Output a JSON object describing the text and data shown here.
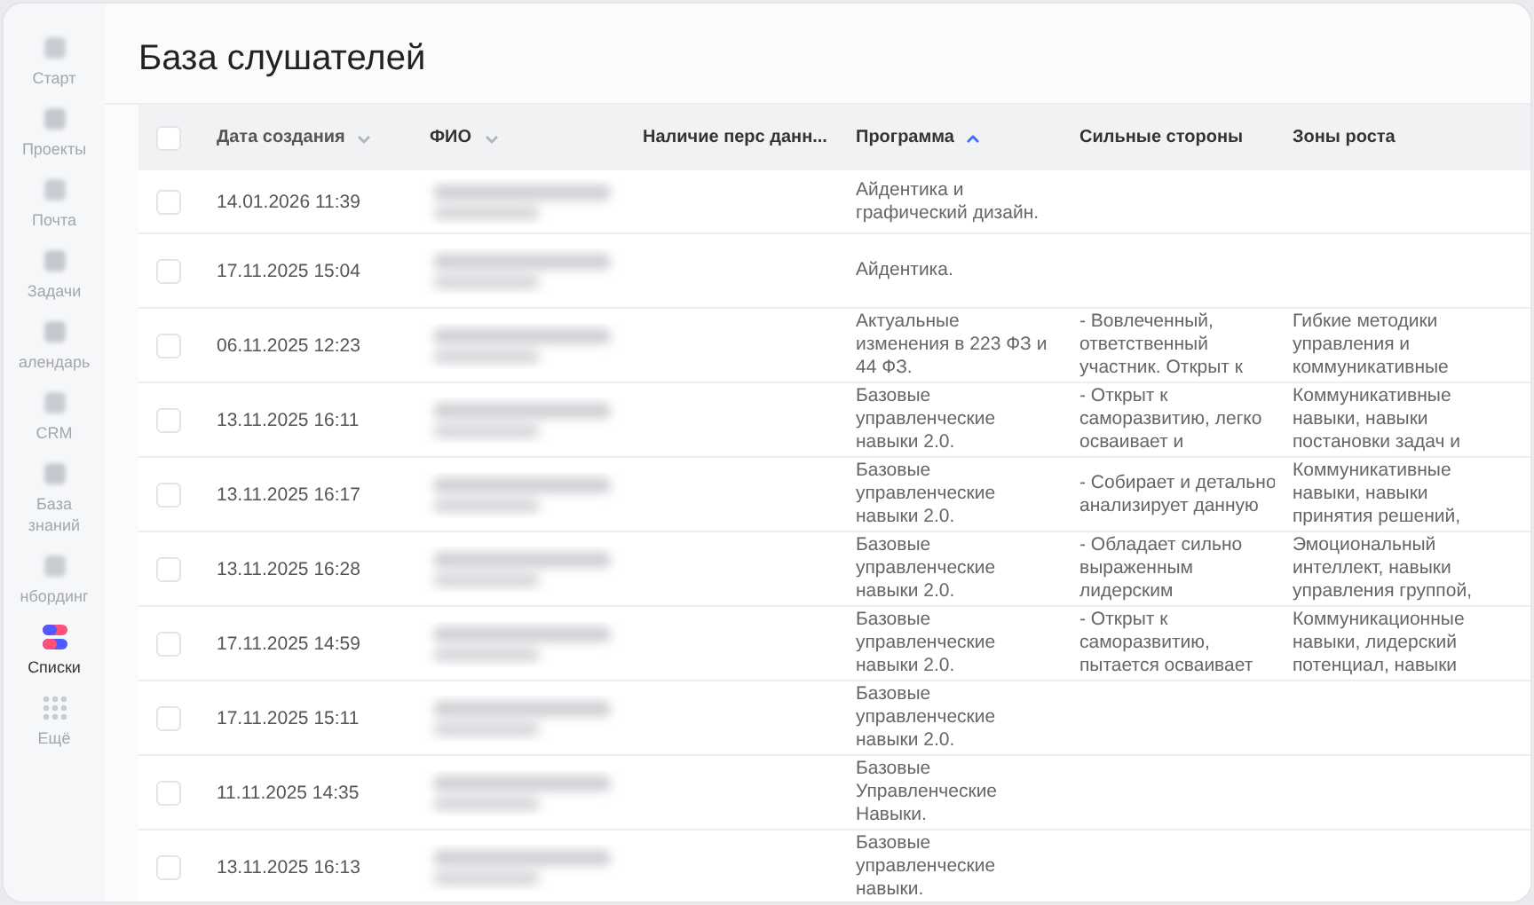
{
  "sidebar": {
    "items": [
      {
        "kind": "start",
        "label": "Старт",
        "selected": false
      },
      {
        "kind": "projects",
        "label": "Проекты",
        "selected": false
      },
      {
        "kind": "mail",
        "label": "Почта",
        "selected": false
      },
      {
        "kind": "tasks",
        "label": "Задачи",
        "selected": false
      },
      {
        "kind": "calendar",
        "label": "алендарь",
        "selected": false
      },
      {
        "kind": "crm",
        "label": "CRM",
        "selected": false
      },
      {
        "kind": "knowledge",
        "label": "База знаний",
        "selected": false
      },
      {
        "kind": "onboarding",
        "label": "нбординг",
        "selected": false
      },
      {
        "kind": "lists",
        "label": "Списки",
        "selected": true
      },
      {
        "kind": "more",
        "label": "Ещё",
        "selected": false
      }
    ]
  },
  "page": {
    "title": "База слушателей"
  },
  "table": {
    "all_checked": false,
    "columns": [
      {
        "label": "Дата создания",
        "has_menu": true,
        "sorted": false
      },
      {
        "label": "ФИО",
        "has_menu": true,
        "sorted": false
      },
      {
        "label": "Наличие перс данн...",
        "has_menu": false,
        "sorted": false
      },
      {
        "label": "Программа",
        "has_menu": false,
        "sorted": true
      },
      {
        "label": "Сильные стороны",
        "has_menu": false,
        "sorted": false
      },
      {
        "label": "Зоны роста",
        "has_menu": false,
        "sorted": false
      }
    ],
    "rows": [
      {
        "checked": false,
        "date": "14.01.2026 11:39",
        "program": "Айдентика и графический дизайн."
      },
      {
        "checked": false,
        "date": "17.11.2025 15:04",
        "program": "Айдентика."
      },
      {
        "checked": false,
        "date": "06.11.2025 12:23",
        "program": "Актуальные изменения в 223 ФЗ и 44 ФЗ.",
        "strengths": "- Вовлеченный, ответственный участник. Открыт к",
        "growth": "Гибкие методики управления и коммуникативные"
      },
      {
        "checked": false,
        "date": "13.11.2025 16:11",
        "program": "Базовые управленческие навыки 2.0.",
        "strengths": "- Открыт к саморазвитию, легко осваивает и",
        "growth": "Коммуникативные навыки, навыки постановки задач и"
      },
      {
        "checked": false,
        "date": "13.11.2025 16:17",
        "program": "Базовые управленческие навыки 2.0.",
        "strengths": "- Собирает и детально анализирует данную",
        "growth": "Коммуникативные навыки, навыки принятия решений,"
      },
      {
        "checked": false,
        "date": "13.11.2025 16:28",
        "program": "Базовые управленческие навыки 2.0.",
        "strengths": "- Обладает сильно выраженным лидерским",
        "growth": "Эмоциональный интеллект, навыки управления группой,"
      },
      {
        "checked": false,
        "date": "17.11.2025 14:59",
        "program": "Базовые управленческие навыки 2.0.",
        "strengths": "- Открыт к саморазвитию, пытается осваивает",
        "growth": "Коммуникационные навыки, лидерский потенциал, навыки"
      },
      {
        "checked": false,
        "date": "17.11.2025 15:11",
        "program": "Базовые управленческие навыки 2.0."
      },
      {
        "checked": false,
        "date": "11.11.2025 14:35",
        "program": "Базовые Управленческие Навыки."
      },
      {
        "checked": false,
        "date": "13.11.2025 16:13",
        "program": "Базовые управленческие навыки."
      }
    ]
  }
}
